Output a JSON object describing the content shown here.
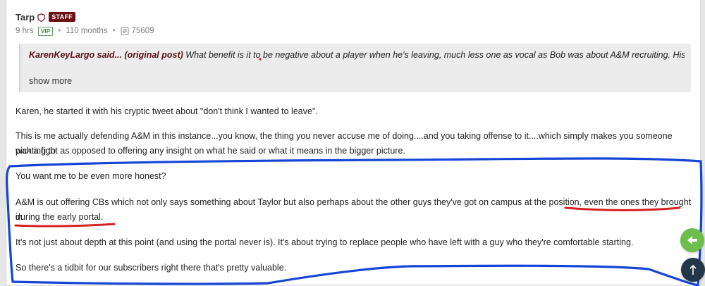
{
  "post": {
    "author": "Tarp",
    "badge": "STAFF",
    "time": "9 hrs",
    "vip": "VIP",
    "tenure": "110 months",
    "post_count": "75609"
  },
  "quote": {
    "author_said": "KarenKeyLargo said... (original post)",
    "text": " What benefit is it to be negative about a player when he's leaving, much less one as vocal as Bob was about A&M recruiting. His fath...",
    "show_more": "show more"
  },
  "body": {
    "p1": "Karen, he started it with his cryptic tweet about \"don't think I wanted to leave\".",
    "p2a": "This is me actually defending A&M in this instance...you know, the thing you never accuse me of doing....and you taking offense to it....which simply makes you someone wanting to",
    "p2b": "pick a fight as opposed to offering any insight on what he said or what it means in the bigger picture.",
    "p3": "You want me to be even more honest?",
    "p4a": "A&M is out offering CBs which not only says something about Taylor but also perhaps about the other guys they've got on campus at the position, even the ones they brought in",
    "p4b": "during the early portal.",
    "p5": "It's not just about depth at this point (and using the portal never is). It's about trying to replace people who have left with a guy who they're comfortable starting.",
    "p6": "So there's a tidbit for our subscribers right there that's pretty valuable."
  },
  "colors": {
    "staff_badge": "#6b0f14",
    "annotation_blue": "#1544d6",
    "annotation_red": "#d42222",
    "fab_green": "#6bbf4a",
    "fab_dark": "#24374a"
  },
  "icons": {
    "author": "shield-icon",
    "posts": "post-count-icon",
    "fab_green": "reply-arrow-icon",
    "fab_dark": "scroll-top-icon"
  }
}
